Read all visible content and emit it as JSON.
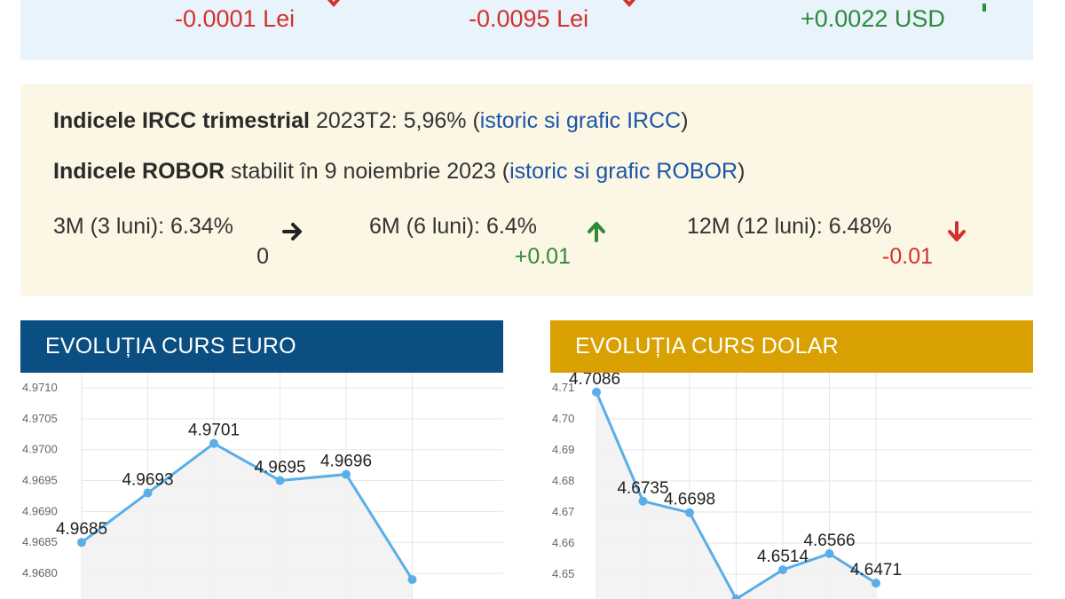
{
  "top": {
    "changes": [
      {
        "text": "-0.0001 Lei",
        "trend": "down"
      },
      {
        "text": "-0.0095 Lei",
        "trend": "down"
      },
      {
        "text": "+0.0022 USD",
        "trend": "up"
      }
    ]
  },
  "ircc": {
    "label": "Indicele IRCC trimestrial",
    "value": "2023T2: 5,96% (",
    "link": "istoric si grafic IRCC",
    "close": ")"
  },
  "robor": {
    "label": "Indicele ROBOR",
    "value": "stabilit în 9 noiembrie 2023 (",
    "link": "istoric si grafic ROBOR",
    "close": ")",
    "rates": [
      {
        "text": "3M (3 luni): 6.34%",
        "delta": "0",
        "trend": "flat"
      },
      {
        "text": "6M (6 luni): 6.4%",
        "delta": "+0.01",
        "trend": "up"
      },
      {
        "text": "12M (12 luni): 6.48%",
        "delta": "-0.01",
        "trend": "down"
      }
    ]
  },
  "colors": {
    "euro_header": "#0b4f82",
    "dolar_header": "#d8a000",
    "line": "#5aaee8",
    "down": "#d2322d",
    "up": "#2e8b3a"
  },
  "chart_data": [
    {
      "type": "area",
      "title": "EVOLUȚIA CURS EURO",
      "yticks": [
        "4.9710",
        "4.9705",
        "4.9700",
        "4.9695",
        "4.9690",
        "4.9685",
        "4.9680"
      ],
      "ylim": [
        4.9678,
        4.971
      ],
      "values": [
        4.9685,
        4.9693,
        4.9701,
        4.9695,
        4.9696,
        4.9679
      ],
      "labels": [
        "4.9685",
        "4.9693",
        "4.9701",
        "4.9695",
        "4.9696",
        ""
      ],
      "grid": true
    },
    {
      "type": "area",
      "title": "EVOLUȚIA CURS DOLAR",
      "yticks": [
        "4.71",
        "4.70",
        "4.69",
        "4.68",
        "4.67",
        "4.66",
        "4.65"
      ],
      "ylim": [
        4.644,
        4.71
      ],
      "values": [
        4.7086,
        4.6735,
        4.6698,
        4.642,
        4.6514,
        4.6566,
        4.6471
      ],
      "labels": [
        "4.7086",
        "4.6735",
        "4.6698",
        "",
        "4.6514",
        "4.6566",
        "4.6471"
      ],
      "grid": true
    }
  ]
}
